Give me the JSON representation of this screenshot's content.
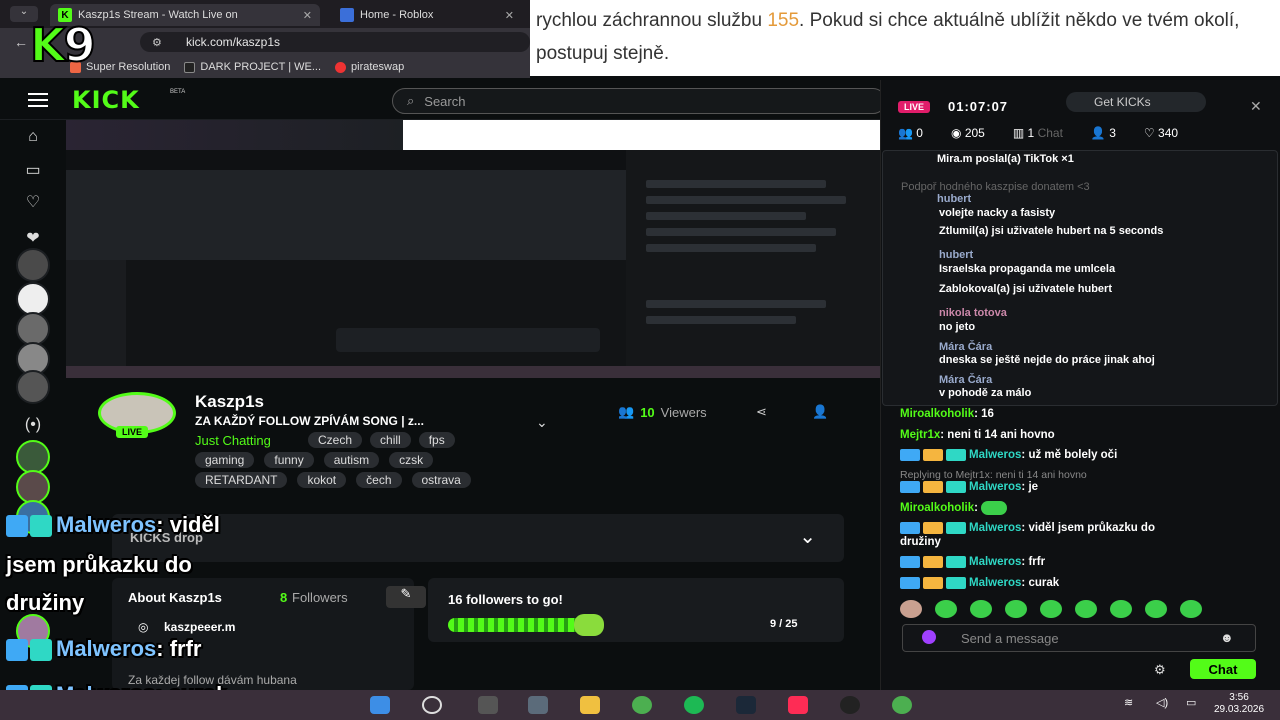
{
  "browser": {
    "tabs": [
      {
        "label": "Kaszp1s Stream - Watch Live on"
      },
      {
        "label": "Home - Roblox"
      }
    ],
    "url": "kick.com/kaszp1s",
    "bookmarks": [
      "Super Resolution",
      "DARK PROJECT | WE...",
      "pirateswap"
    ]
  },
  "overlay_logo": {
    "k": "K",
    "n": "9"
  },
  "notice": {
    "before": "rychlou záchrannou službu ",
    "number": "155",
    "after": ". Pokud si chce aktuálně ublížit někdo ve tvém okolí, postupuj stejně."
  },
  "header": {
    "logo": "KICK",
    "beta": "BETA",
    "search_placeholder": "Search"
  },
  "stream": {
    "streamer": "Kaszp1s",
    "live_badge": "LIVE",
    "title": "ZA KAŽDÝ FOLLOW ZPÍVÁM SONG | z...",
    "category": "Just Chatting",
    "tags": [
      "Czech",
      "chill",
      "fps",
      "gaming",
      "funny",
      "autism",
      "czsk",
      "RETARDANT",
      "kokot",
      "čech",
      "ostrava"
    ],
    "viewers_count": "10",
    "viewers_label": "Viewers"
  },
  "kicks_drop": {
    "label": "KICKS drop"
  },
  "about": {
    "heading": "About Kaszp1s",
    "followers_count": "8",
    "followers_label": "Followers",
    "social": "kaszpeeer.m",
    "desc": "Za každej follow dávám hubana"
  },
  "follow_goal": {
    "label": "16 followers to go!",
    "progress": "9 / 25",
    "fraction": 0.36
  },
  "overlay_chat": [
    {
      "user": "Malweros",
      "text": ": viděl"
    },
    {
      "user": "",
      "text": "jsem průkazku do"
    },
    {
      "user": "",
      "text": "družiny"
    },
    {
      "user": "Malweros",
      "text": ": frfr"
    },
    {
      "user": "Malweros",
      "text": ": curak"
    }
  ],
  "chat": {
    "live": "LIVE",
    "uptime": "01:07:07",
    "get_kicks": "Get KICKs",
    "stats": {
      "a": "0",
      "b": "205",
      "c": "1",
      "d": "3",
      "likes": "340"
    },
    "chat_label": "Chat",
    "pinned": [
      {
        "user": "Mira.m",
        "text": " poslal(a) TikTok  ×1"
      },
      {
        "user": "",
        "text": "Podpoř hodného kaszpise donatem <3"
      },
      {
        "user": "hubert",
        "text": ""
      },
      {
        "user": "",
        "text": "volejte nacky a fasisty"
      },
      {
        "user": "",
        "text": "Ztlumil(a) jsi uživatele hubert na 5 seconds"
      },
      {
        "user": "hubert",
        "text": ""
      },
      {
        "user": "",
        "text": "Israelska propaganda me umlcela"
      },
      {
        "user": "",
        "text": "Zablokoval(a) jsi uživatele hubert"
      },
      {
        "user": "nikola totova",
        "text": ""
      },
      {
        "user": "",
        "text": "no jeto"
      },
      {
        "user": "Mára Čára",
        "text": ""
      },
      {
        "user": "",
        "text": "dneska se ještě nejde do práce jinak ahoj"
      },
      {
        "user": "Mára Čára",
        "text": ""
      },
      {
        "user": "",
        "text": "v pohodě za málo"
      }
    ],
    "messages": [
      {
        "user": "Miroalkoholik",
        "text": ": 16"
      },
      {
        "user": "Mejtr1x",
        "text": ": neni ti 14 ani hovno"
      },
      {
        "user": "Malweros",
        "text": ": už mě bolely oči"
      },
      {
        "reply": "Replying to Mejtr1x: neni ti 14 ani hovno"
      },
      {
        "user": "Malweros",
        "text": ": je"
      },
      {
        "user": "Miroalkoholik",
        "text": ":"
      },
      {
        "user": "Malweros",
        "text": ": viděl jsem průkazku do"
      },
      {
        "user": "",
        "text": "družiny"
      },
      {
        "user": "Malweros",
        "text": ": frfr"
      },
      {
        "user": "Malweros",
        "text": ": curak"
      }
    ],
    "input_placeholder": "Send a message",
    "send_label": "Chat"
  },
  "taskbar": {
    "time": "3:56",
    "date": "29.03.2026"
  }
}
